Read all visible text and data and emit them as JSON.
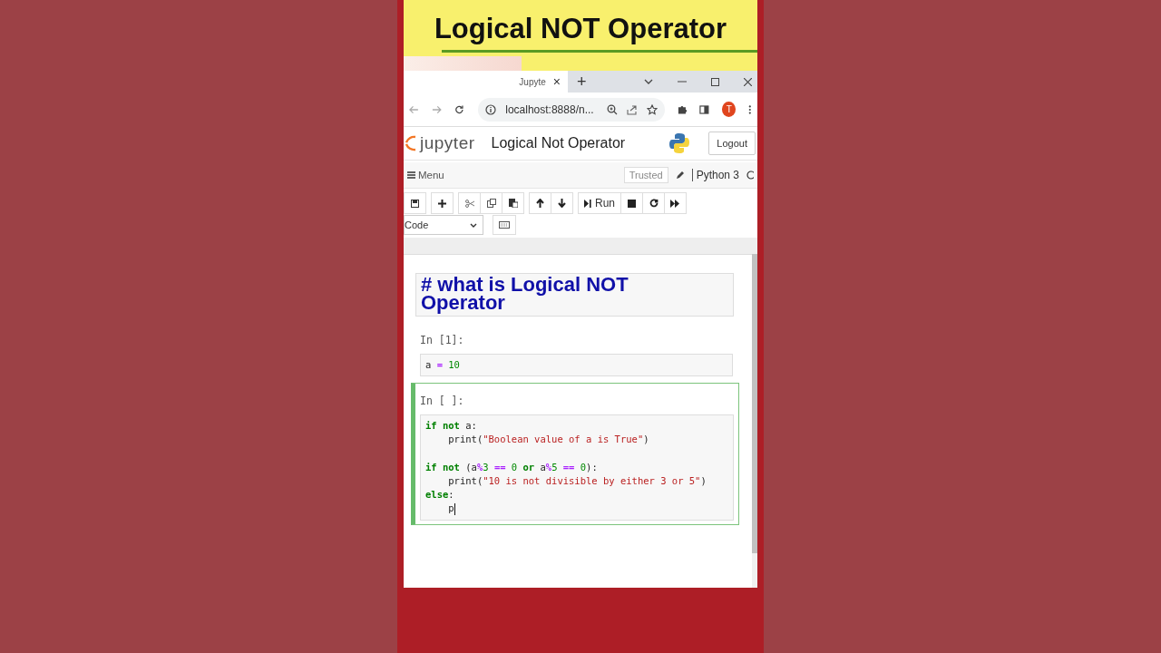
{
  "banner": {
    "title": "Logical NOT Operator"
  },
  "browser": {
    "tab": {
      "title": "Jupyte",
      "close": "×"
    },
    "new_tab": "+",
    "address": "localhost:8888/n...",
    "profile": "T"
  },
  "jupyter": {
    "logo": "jupyter",
    "notebook_title": "Logical Not Operator",
    "logout": "Logout",
    "menu": "Menu",
    "trusted": "Trusted",
    "kernel": "Python 3",
    "run": "Run",
    "cell_type": "Code"
  },
  "cells": [
    {
      "kind": "markdown",
      "text": "# what is Logical NOT Operator",
      "selected": false
    },
    {
      "kind": "code",
      "prompt": "In [1]:",
      "selected": false,
      "lines": [
        {
          "tokens": [
            {
              "t": "a",
              "kind": "name"
            },
            {
              "t": " = ",
              "kind": "op"
            },
            {
              "t": "10",
              "kind": "num"
            }
          ]
        }
      ]
    },
    {
      "kind": "code",
      "prompt": "In [ ]:",
      "selected": true,
      "lines": [
        {
          "tokens": [
            {
              "t": "if not",
              "kind": "kw"
            },
            {
              "t": " a:",
              "kind": "name"
            }
          ],
          "cursor": false
        },
        {
          "tokens": [
            {
              "t": "    print(",
              "kind": "name"
            },
            {
              "t": "\"Boolean value of a is True\"",
              "kind": "str"
            },
            {
              "t": ")",
              "kind": "name"
            }
          ],
          "cursor": false
        },
        {
          "cursor": false
        },
        {
          "tokens": [
            {
              "t": "if not",
              "kind": "kw"
            },
            {
              "t": " (a",
              "kind": "name"
            },
            {
              "t": "%",
              "kind": "op"
            },
            {
              "t": "3",
              "kind": "num"
            },
            {
              "t": " == ",
              "kind": "op"
            },
            {
              "t": "0",
              "kind": "num"
            },
            {
              "t": " or ",
              "kind": "kw"
            },
            {
              "t": "a",
              "kind": "name"
            },
            {
              "t": "%",
              "kind": "op"
            },
            {
              "t": "5",
              "kind": "num"
            },
            {
              "t": " == ",
              "kind": "op"
            },
            {
              "t": "0",
              "kind": "num"
            },
            {
              "t": "):",
              "kind": "name"
            }
          ],
          "cursor": false
        },
        {
          "tokens": [
            {
              "t": "    print(",
              "kind": "name"
            },
            {
              "t": "\"10 is not divisible by either 3 or 5\"",
              "kind": "str"
            },
            {
              "t": ")",
              "kind": "name"
            }
          ],
          "cursor": false
        },
        {
          "tokens": [
            {
              "t": "else",
              "kind": "kw"
            },
            {
              "t": ":",
              "kind": "name"
            }
          ],
          "cursor": false
        },
        {
          "tokens": [
            {
              "t": "    p",
              "kind": "name"
            }
          ],
          "cursor": true
        }
      ]
    }
  ]
}
